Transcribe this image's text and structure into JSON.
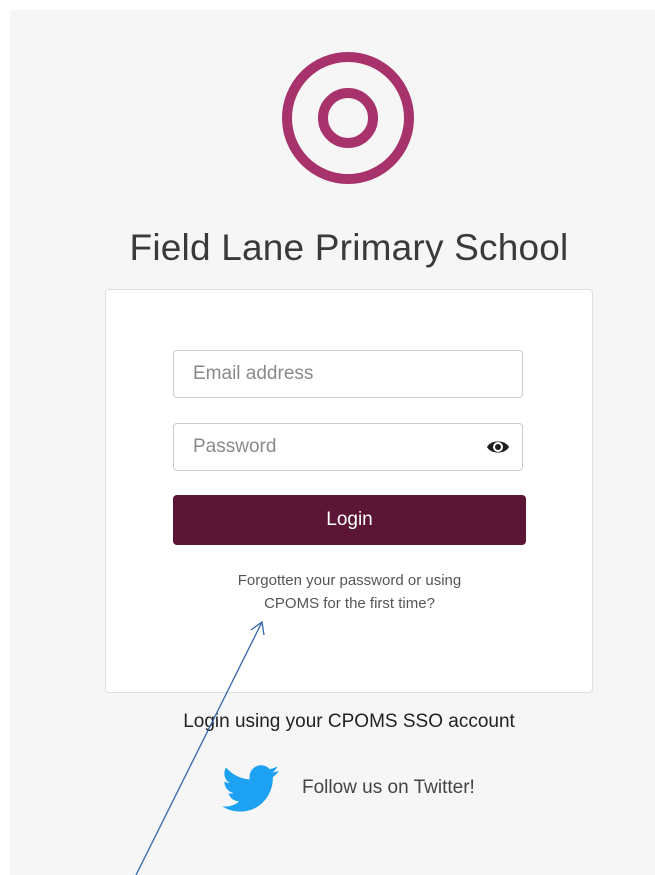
{
  "school": {
    "name": "Field Lane Primary School",
    "brand_color": "#a8326c"
  },
  "login_form": {
    "email_placeholder": "Email address",
    "password_placeholder": "Password",
    "login_label": "Login",
    "button_color": "#5a1634",
    "forgot_line1": "Forgotten your password or using",
    "forgot_line2": "CPOMS for the first time?"
  },
  "footer": {
    "sso_label": "Login using your CPOMS SSO account",
    "twitter_label": "Follow us on Twitter!",
    "twitter_color": "#1da1f2"
  },
  "icons": {
    "logo": "cpoms-ring-logo-icon",
    "password_toggle": "eye-icon",
    "twitter": "twitter-bird-icon",
    "annotation": "arrow-icon"
  }
}
